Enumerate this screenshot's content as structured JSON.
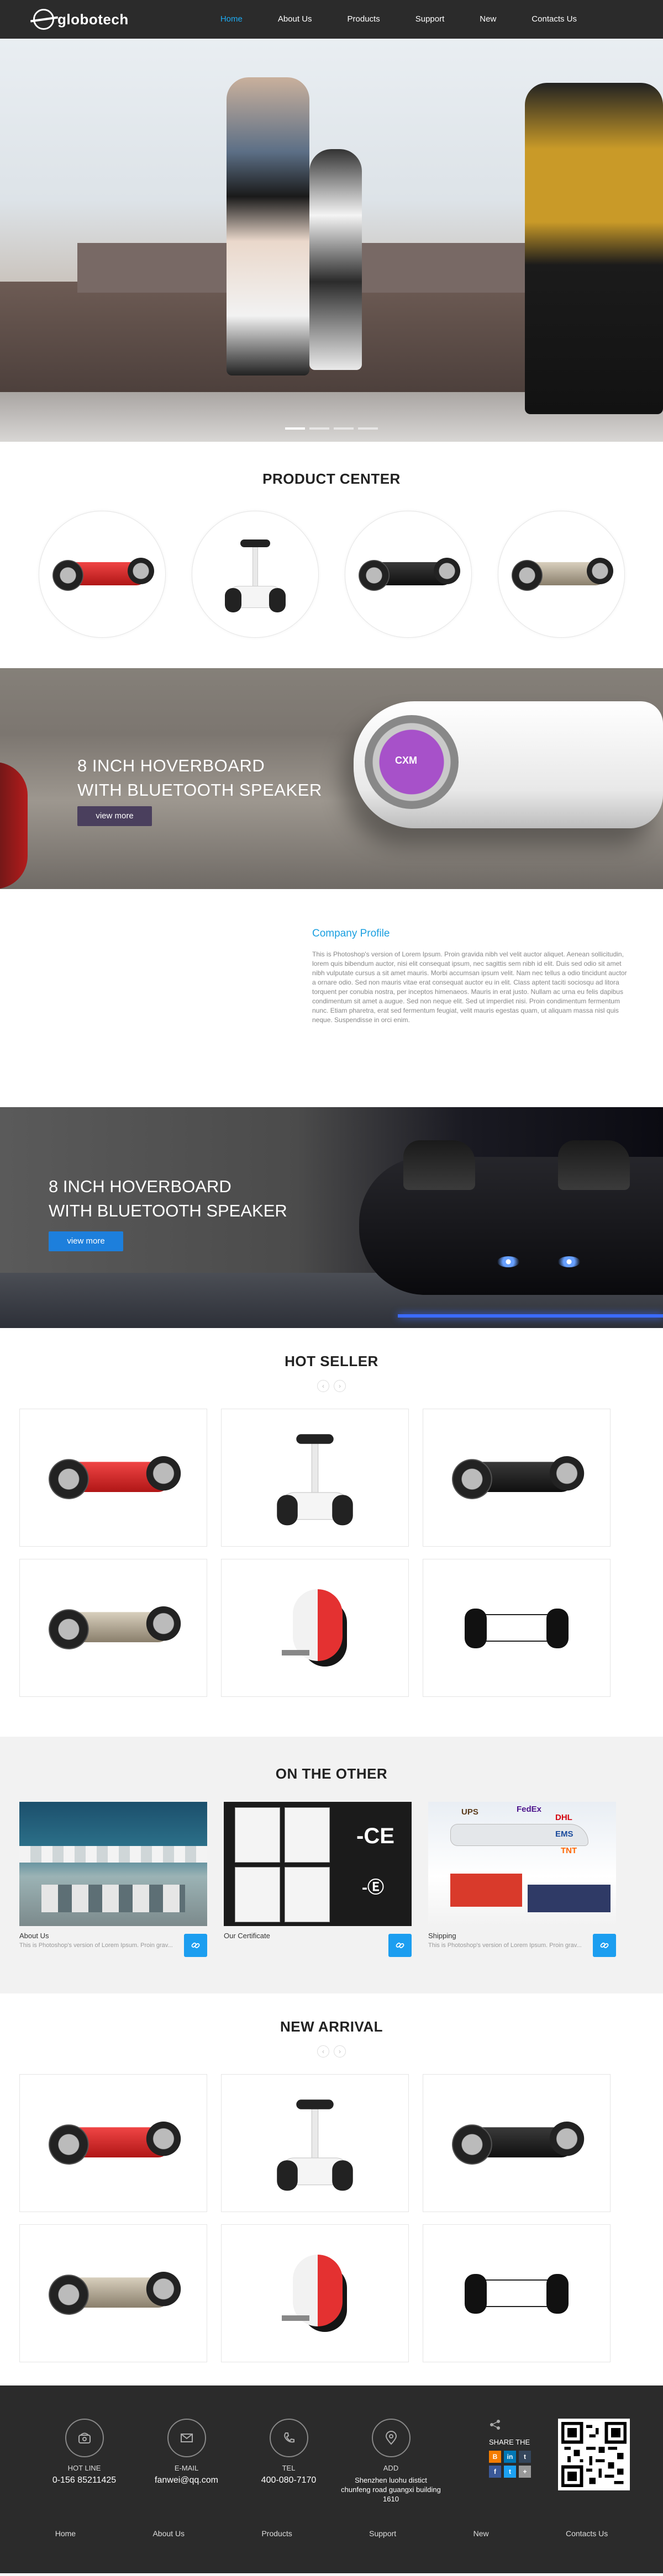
{
  "header": {
    "logo": "globotech",
    "nav": [
      "Home",
      "About Us",
      "Products",
      "Support",
      "New",
      "Contacts Us"
    ],
    "active_index": 0,
    "accent_color": "#1eaaf1"
  },
  "hero": {
    "slides": 4,
    "active_slide": 0
  },
  "product_center": {
    "title": "PRODUCT CENTER",
    "items": [
      "red-hoverboard",
      "white-segway",
      "black-hoverboard",
      "champagne-hoverboard"
    ]
  },
  "banner1": {
    "line1": "8 INCH HOVERBOARD",
    "line2": "WITH BLUETOOTH SPEAKER",
    "button": "view more",
    "hub_text": "CXM"
  },
  "profile": {
    "title": "Company Profile",
    "text": "This is Photoshop's version of Lorem Ipsum. Proin gravida nibh vel velit auctor aliquet. Aenean sollicitudin, lorem quis bibendum auctor, nisi elit consequat ipsum, nec sagittis sem nibh id elit. Duis sed odio sit amet nibh vulputate cursus a sit amet mauris. Morbi accumsan ipsum velit. Nam nec tellus a odio tincidunt auctor a ornare odio. Sed non mauris vitae erat consequat auctor eu in elit. Class aptent taciti sociosqu ad litora torquent per conubia nostra, per inceptos himenaeos. Mauris in erat justo. Nullam ac urna eu felis dapibus condimentum sit amet a augue. Sed non neque elit. Sed ut imperdiet nisi. Proin condimentum fermentum nunc. Etiam pharetra, erat sed fermentum feugiat, velit mauris egestas quam, ut aliquam massa nisl quis neque. Suspendisse in orci enim."
  },
  "banner2": {
    "line1": "8 INCH HOVERBOARD",
    "line2": "WITH BLUETOOTH SPEAKER",
    "button": "view more"
  },
  "hot_seller": {
    "title": "HOT SELLER",
    "prev": "‹",
    "next": "›",
    "products": [
      "red-hoverboard",
      "white-segway",
      "black-hoverboard",
      "champagne-hoverboard",
      "red-unicycle",
      "white-mini-scooter"
    ]
  },
  "on_the_other": {
    "title": "ON THE OTHER",
    "cards": [
      {
        "title": "About Us",
        "text": "This is Photoshop's version of Lorem Ipsum. Proin grav..."
      },
      {
        "title": "Our Certificate",
        "text": ""
      },
      {
        "title": "Shipping",
        "text": "This is Photoshop's version of Lorem Ipsum. Proin grav..."
      }
    ],
    "shipping_logos": [
      "UPS",
      "FedEx",
      "DHL",
      "EMS",
      "TNT"
    ]
  },
  "new_arrival": {
    "title": "NEW ARRIVAL",
    "prev": "‹",
    "next": "›",
    "products": [
      "red-hoverboard",
      "white-segway",
      "black-hoverboard",
      "champagne-hoverboard",
      "red-unicycle",
      "white-mini-scooter"
    ]
  },
  "footer": {
    "contacts": [
      {
        "label": "HOT LINE",
        "value": "0-156 85211425",
        "icon": "phone-icon"
      },
      {
        "label": "E-MAIL",
        "value": "fanwei@qq.com",
        "icon": "mail-icon"
      },
      {
        "label": "TEL",
        "value": "400-080-7170",
        "icon": "tel-icon"
      },
      {
        "label": "ADD",
        "value": "Shenzhen luohu distict chunfeng road guangxi building 1610",
        "icon": "location-icon"
      }
    ],
    "share_label": "SHARE THE",
    "share_icons": [
      "blogger",
      "linkedin",
      "tumblr",
      "facebook",
      "twitter",
      "more"
    ],
    "nav": [
      "Home",
      "About Us",
      "Products",
      "Support",
      "New",
      "Contacts Us"
    ]
  }
}
